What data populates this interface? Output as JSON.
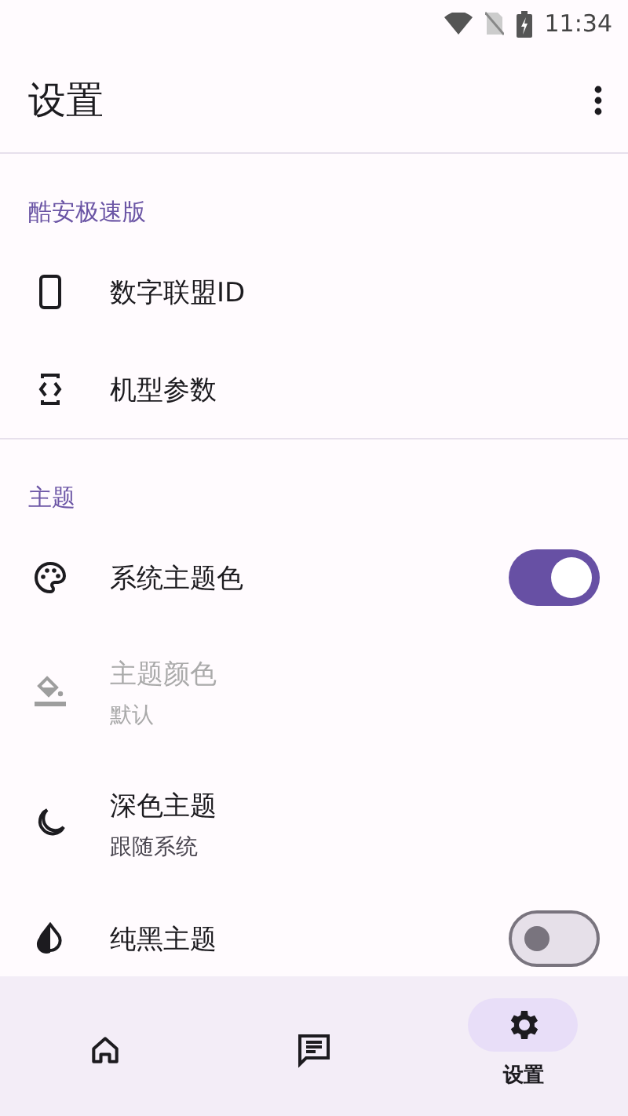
{
  "status_bar": {
    "time": "11:34"
  },
  "app_bar": {
    "title": "设置"
  },
  "sections": [
    {
      "header": "酷安极速版",
      "items": [
        {
          "kind": "plain",
          "title": "数字联盟ID",
          "disabled": false
        },
        {
          "kind": "plain",
          "title": "机型参数",
          "disabled": false
        }
      ]
    },
    {
      "header": "主题",
      "items": [
        {
          "kind": "switch",
          "title": "系统主题色",
          "disabled": false,
          "on": true
        },
        {
          "kind": "subtitle",
          "title": "主题颜色",
          "subtitle": "默认",
          "disabled": true
        },
        {
          "kind": "subtitle",
          "title": "深色主题",
          "subtitle": "跟随系统",
          "disabled": false
        },
        {
          "kind": "switch",
          "title": "纯黑主题",
          "disabled": false,
          "on": false
        }
      ]
    }
  ],
  "nav": [
    {
      "selected": false
    },
    {
      "selected": false
    },
    {
      "label": "设置",
      "selected": true
    }
  ]
}
